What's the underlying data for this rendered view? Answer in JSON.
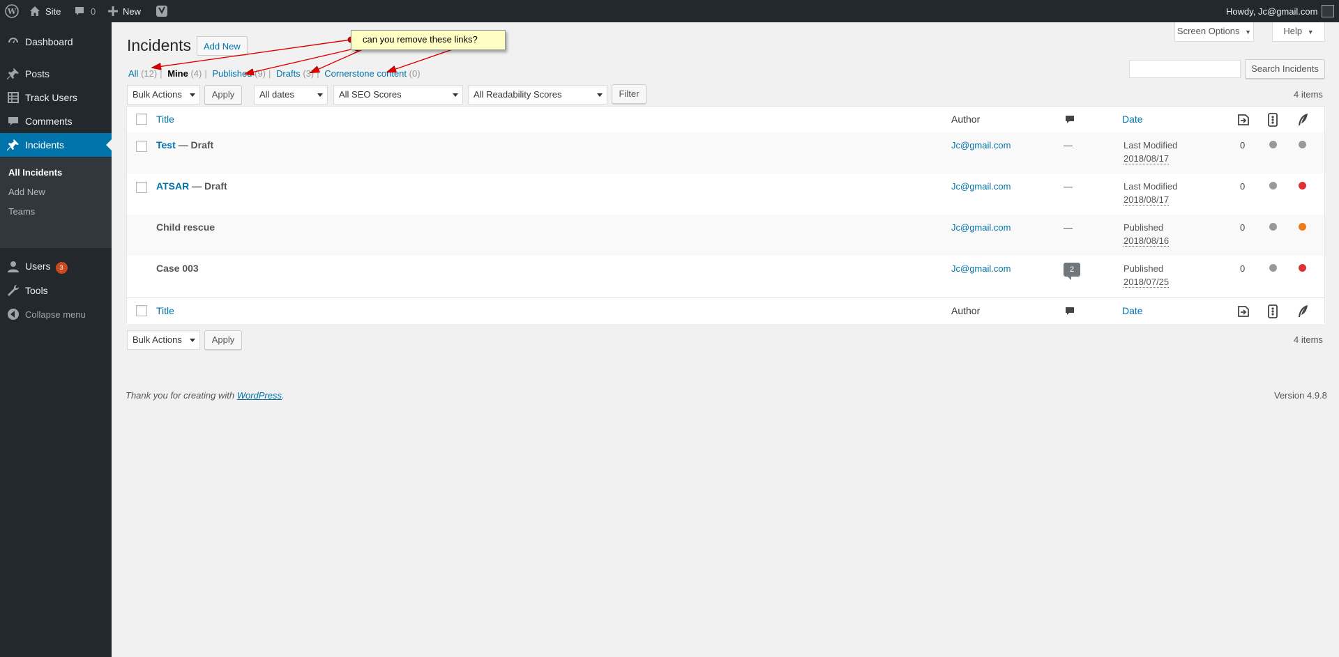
{
  "adminbar": {
    "site_label": "Site",
    "comments_count": "0",
    "new_label": "New",
    "howdy": "Howdy, Jc@gmail.com"
  },
  "sidebar": {
    "items": [
      {
        "label": "Dashboard",
        "icon": "dashboard-icon"
      },
      {
        "label": "Posts",
        "icon": "pin-icon"
      },
      {
        "label": "Track Users",
        "icon": "table-icon"
      },
      {
        "label": "Comments",
        "icon": "comment-icon"
      },
      {
        "label": "Incidents",
        "icon": "pin-icon",
        "current": true
      },
      {
        "label": "Users",
        "icon": "user-icon",
        "badge": "3"
      },
      {
        "label": "Tools",
        "icon": "wrench-icon"
      },
      {
        "label": "Collapse menu",
        "icon": "collapse-icon"
      }
    ],
    "submenu": [
      "All Incidents",
      "Add New",
      "Teams"
    ]
  },
  "header": {
    "title": "Incidents",
    "add_new": "Add New",
    "screen_options": "Screen Options",
    "help": "Help"
  },
  "views": {
    "all": "All",
    "all_count": "(12)",
    "mine": "Mine",
    "mine_count": "(4)",
    "published": "Published",
    "published_count": "(9)",
    "drafts": "Drafts",
    "drafts_count": "(3)",
    "cornerstone": "Cornerstone content",
    "cornerstone_count": "(0)",
    "separator": "|"
  },
  "search": {
    "button": "Search Incidents",
    "value": ""
  },
  "filters": {
    "bulk_actions": "Bulk Actions",
    "apply": "Apply",
    "dates": "All dates",
    "seo": "All SEO Scores",
    "readability": "All Readability Scores",
    "filter": "Filter",
    "items_count": "4 items"
  },
  "table": {
    "columns": {
      "title": "Title",
      "author": "Author",
      "date": "Date"
    },
    "rows": [
      {
        "title": "Test",
        "state": "— Draft",
        "author": "Jc@gmail.com",
        "comments": "—",
        "date_label": "Last Modified",
        "date": "2018/08/17",
        "links": "0",
        "seo_color": "#999999",
        "read_color": "#999999",
        "has_checkbox": true,
        "title_link": true
      },
      {
        "title": "ATSAR",
        "state": "— Draft",
        "author": "Jc@gmail.com",
        "comments": "—",
        "date_label": "Last Modified",
        "date": "2018/08/17",
        "links": "0",
        "seo_color": "#999999",
        "read_color": "#dc3232",
        "has_checkbox": true,
        "title_link": true
      },
      {
        "title": "Child rescue",
        "state": "",
        "author": "Jc@gmail.com",
        "comments": "—",
        "date_label": "Published",
        "date": "2018/08/16",
        "links": "0",
        "seo_color": "#999999",
        "read_color": "#ee7c1b",
        "has_checkbox": false,
        "title_link": false
      },
      {
        "title": "Case 003",
        "state": "",
        "author": "Jc@gmail.com",
        "comments": "2",
        "date_label": "Published",
        "date": "2018/07/25",
        "links": "0",
        "seo_color": "#999999",
        "read_color": "#dc3232",
        "has_checkbox": false,
        "title_link": false
      }
    ]
  },
  "footer": {
    "thanks_prefix": "Thank you for creating with",
    "wordpress": "WordPress",
    "thanks_suffix": ".",
    "version": "Version 4.9.8"
  },
  "annotation": {
    "text": "can you remove these links?"
  },
  "colors": {
    "accent": "#0073aa",
    "sidebar": "#23282d",
    "badge": "#ca4a1f",
    "arrow": "#e00000"
  }
}
